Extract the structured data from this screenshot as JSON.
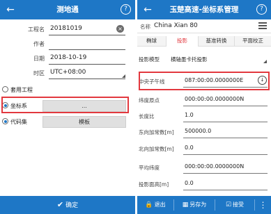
{
  "left": {
    "header": {
      "title": "测地通",
      "back_icon": "back-arrow-icon",
      "help_icon": "help-icon",
      "help_glyph": "?"
    },
    "fields": [
      {
        "label": "工程名",
        "value": "20181019"
      },
      {
        "label": "作者",
        "value": ""
      },
      {
        "label": "日期",
        "value": "2018-10-19"
      },
      {
        "label": "时区",
        "value": "UTC+08:00"
      }
    ],
    "options": [
      {
        "label": "套用工程",
        "button": ""
      },
      {
        "label": "坐标系",
        "button": "..."
      },
      {
        "label": "代码集",
        "button": "模板"
      }
    ],
    "confirm_label": "确定"
  },
  "right": {
    "header": {
      "title": "玉楚高速-坐标系管理",
      "help_glyph": "?"
    },
    "name_label": "名称",
    "name_value": "China Xian 80",
    "tabs": [
      "椭球",
      "投影",
      "基准转换",
      "平面校正"
    ],
    "active_tab": 1,
    "projection_model_label": "投影模型",
    "projection_model_value": "横轴墨卡托投影",
    "params": [
      {
        "label": "中央子午线",
        "value": "087:00:00.0000000E"
      },
      {
        "label": "纬度原点",
        "value": "000:00:00.0000000N"
      },
      {
        "label": "长度比",
        "value": "1.0"
      },
      {
        "label": "东向加常数[m]",
        "value": "500000.0"
      },
      {
        "label": "北向加常数[m]",
        "value": "0.0"
      },
      {
        "label": "平均纬度",
        "value": "000:00:00.0000000N"
      },
      {
        "label": "投影面高[m]",
        "value": "0.0"
      }
    ],
    "bottom": {
      "exit": "退出",
      "save_as": "另存为",
      "accept": "接受"
    }
  },
  "colors": {
    "primary": "#1e77c6",
    "highlight": "#e2383e"
  }
}
